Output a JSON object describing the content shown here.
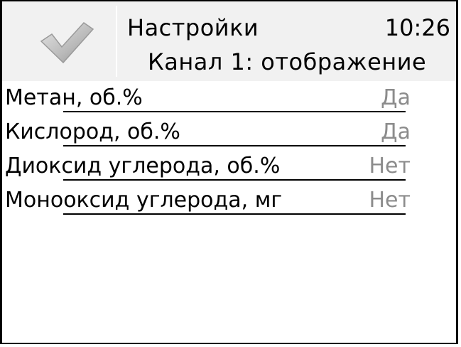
{
  "header": {
    "title": "Настройки",
    "time": "10:26",
    "subtitle": "Канал 1: отображение",
    "confirm_icon": "checkmark-icon"
  },
  "rows": [
    {
      "label": "Метан, об.%",
      "value": "Да"
    },
    {
      "label": "Кислород, об.%",
      "value": "Да"
    },
    {
      "label": "Диоксид углерода, об.%",
      "value": "Нет"
    },
    {
      "label": "Монооксид углерода, мг",
      "value": "Нет"
    }
  ],
  "colors": {
    "header_bg": "#f1f1f1",
    "value_text": "#8c8c8c",
    "check_fill": "#bdbdbd"
  }
}
